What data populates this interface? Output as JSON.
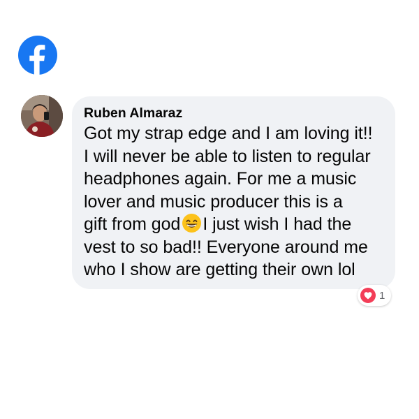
{
  "brand": {
    "icon": "facebook-logo-icon",
    "color": "#1877f2"
  },
  "comment": {
    "author": "Ruben Almaraz",
    "text_before_emoji": "Got my strap edge and I am loving it!!\nI will never be able to listen to regular\nheadphones again. For me a music\nlover and music producer this is a\ngift from god",
    "emoji": "grinning-face-with-smiling-eyes-emoji",
    "text_after_emoji": "I just wish I had the\nvest to so bad!! Everyone around me\nwho I show are getting their own lol",
    "bubble_color": "#f0f2f5"
  },
  "reactions": {
    "icon": "love-heart-icon",
    "count": "1",
    "color": "#f33e58"
  }
}
